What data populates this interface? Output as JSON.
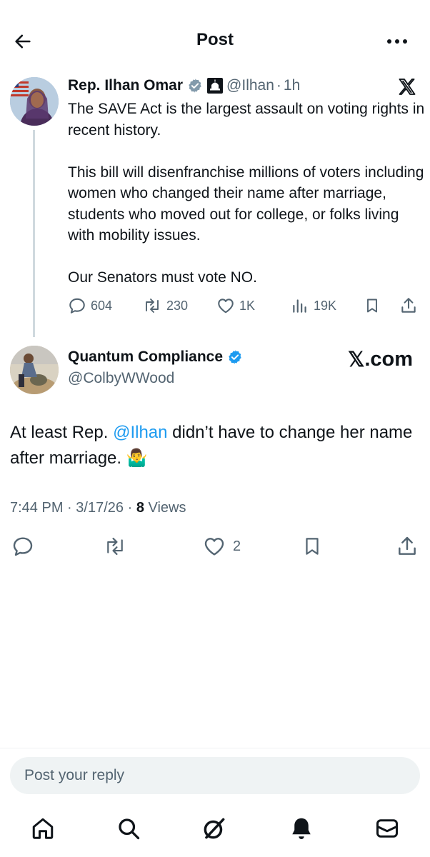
{
  "header": {
    "title": "Post",
    "back_icon": "arrow-left-icon",
    "more_icon": "more-horizontal-icon"
  },
  "quoted_post": {
    "author_name": "Rep. Ilhan Omar",
    "handle": "@Ilhan",
    "separator": "·",
    "time": "1h",
    "badges": [
      "verified-gray-icon",
      "capitol-icon"
    ],
    "paragraphs": [
      "The SAVE Act is the largest assault on voting rights in recent history.",
      "This bill will disenfranchise millions of voters including women who changed their name after marriage, students who moved out for college, or folks living with mobility issues.",
      "Our Senators must vote NO."
    ],
    "stats": {
      "replies": "604",
      "reposts": "230",
      "likes": "1K",
      "views": "19K"
    }
  },
  "post": {
    "author_name": "Quantum Compliance",
    "handle": "@ColbyWWood",
    "watermark_mark": "𝕏",
    "watermark_text": ".com",
    "text_before": "At least Rep. ",
    "mention": "@Ilhan",
    "text_after": " didn’t have to change her name after marriage. 🤷‍♂️",
    "time": "7:44 PM",
    "separator": "·",
    "date": "3/17/26",
    "views_count": "8",
    "views_label": "Views",
    "likes": "2"
  },
  "reply": {
    "placeholder": "Post your reply"
  },
  "tabs": [
    "home-icon",
    "search-icon",
    "grok-icon",
    "notifications-bell-icon",
    "messages-icon"
  ],
  "colors": {
    "text": "#0f1419",
    "secondary": "#536471",
    "accent": "#1d9bf0",
    "input_bg": "#eff3f4"
  }
}
